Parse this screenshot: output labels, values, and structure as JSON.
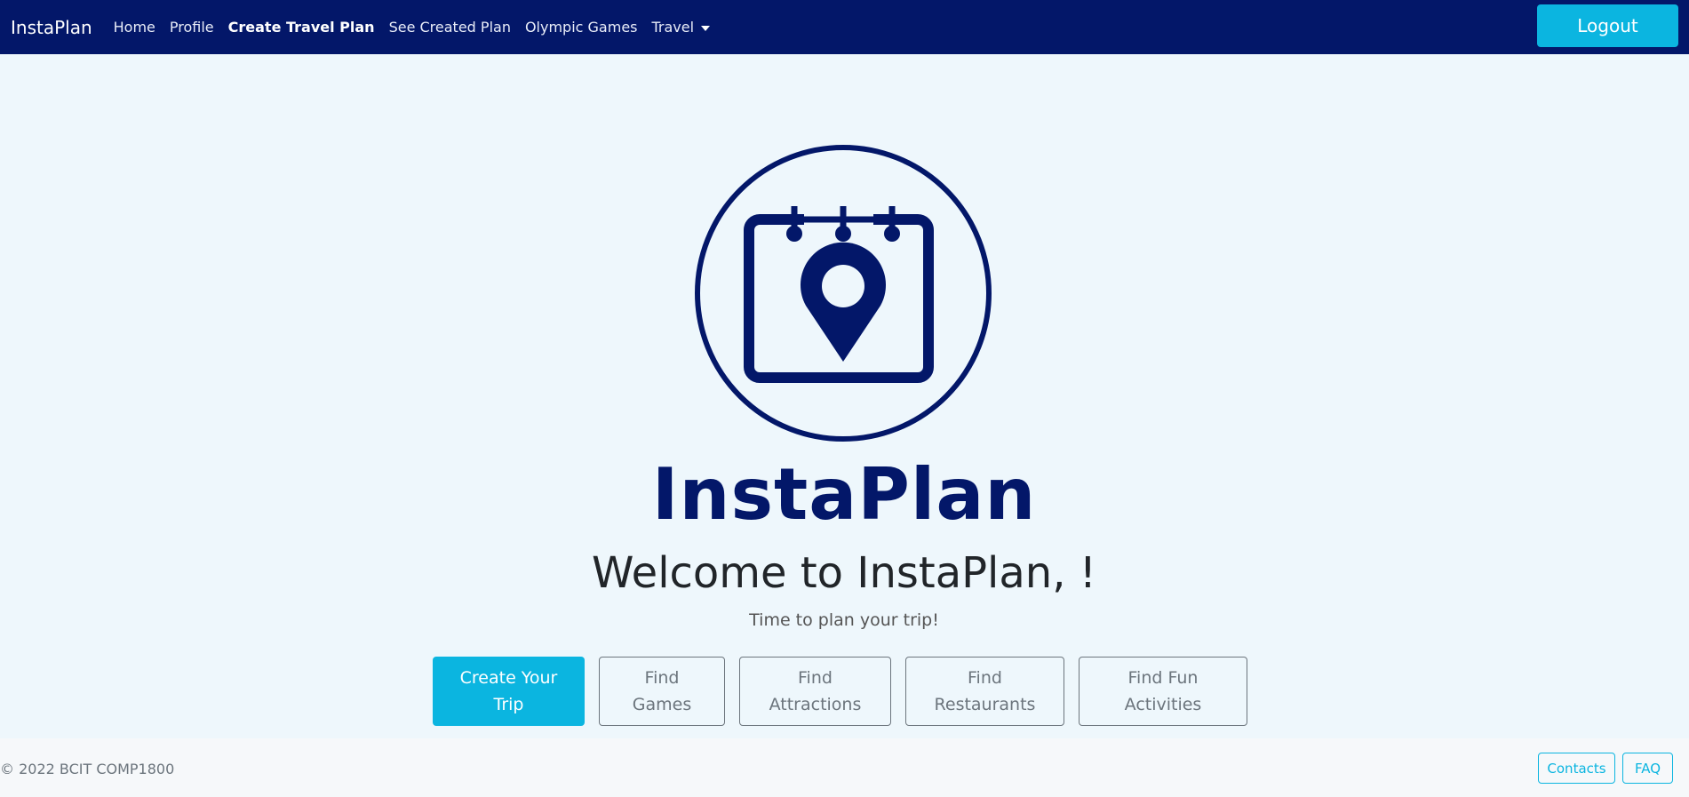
{
  "navbar": {
    "brand": "InstaPlan",
    "links": [
      "Home",
      "Profile",
      "Create Travel Plan",
      "See Created Plan",
      "Olympic Games",
      "Travel"
    ],
    "logout_label": "Logout"
  },
  "hero": {
    "logo_text": "InstaPlan",
    "welcome": "Welcome to InstaPlan, !",
    "tagline": "Time to plan your trip!"
  },
  "actions": {
    "create_trip": [
      "Create Your",
      "Trip"
    ],
    "find_games": [
      "Find",
      "Games"
    ],
    "find_attractions": [
      "Find",
      "Attractions"
    ],
    "find_restaurants": [
      "Find",
      "Restaurants"
    ],
    "find_fun": [
      "Find Fun",
      "Activities"
    ]
  },
  "footer": {
    "copyright": "© 2022 BCIT COMP1800",
    "contacts_label": "Contacts",
    "faq_label": "FAQ"
  },
  "colors": {
    "navbar_bg": "#031769",
    "accent": "#0bb5e0",
    "page_bg": "#eef7fc"
  },
  "icons": [
    "calendar-location-icon",
    "dropdown-caret-icon"
  ]
}
